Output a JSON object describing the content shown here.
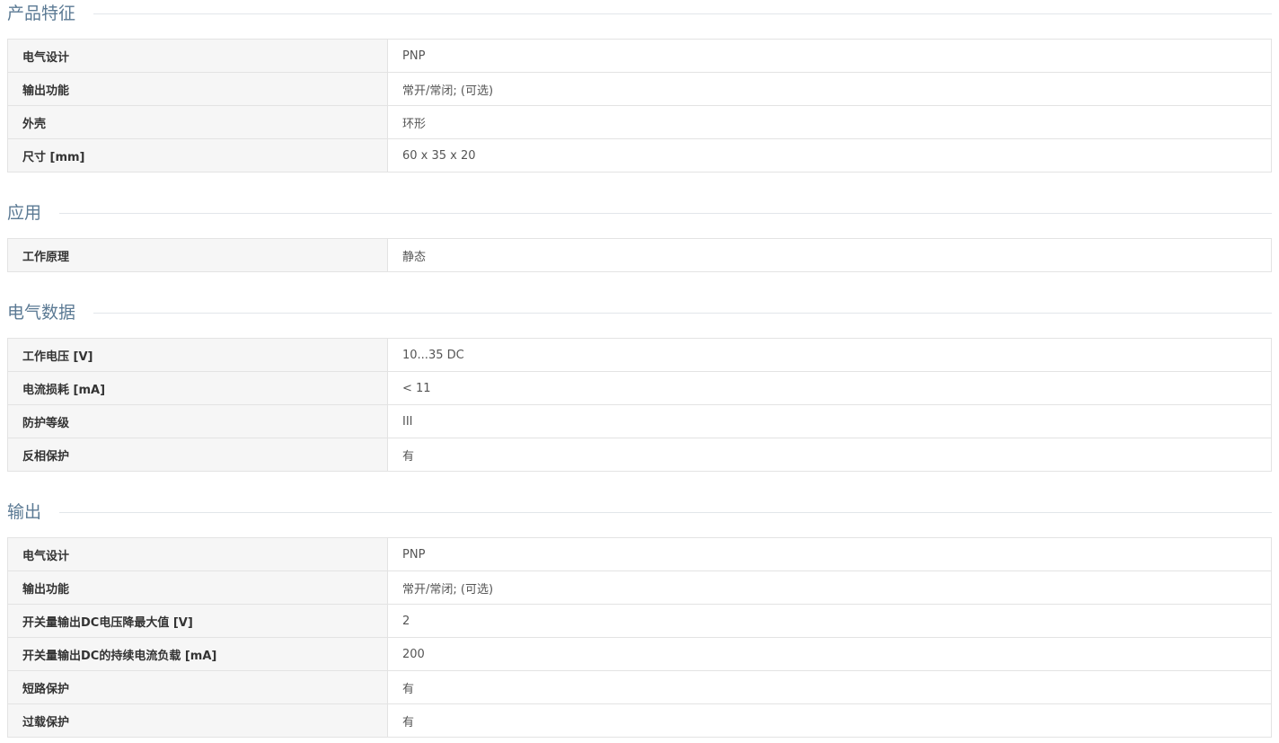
{
  "sections": [
    {
      "title": "产品特征",
      "rows": [
        {
          "label": "电气设计",
          "value": "PNP"
        },
        {
          "label": "输出功能",
          "value": "常开/常闭; (可选)"
        },
        {
          "label": "外壳",
          "value": "环形"
        },
        {
          "label": "尺寸 [mm]",
          "value": "60 x 35 x 20"
        }
      ]
    },
    {
      "title": "应用",
      "rows": [
        {
          "label": "工作原理",
          "value": "静态"
        }
      ]
    },
    {
      "title": "电气数据",
      "rows": [
        {
          "label": "工作电压 [V]",
          "value": "10...35 DC"
        },
        {
          "label": "电流损耗 [mA]",
          "value": "< 11"
        },
        {
          "label": "防护等级",
          "value": "III"
        },
        {
          "label": "反相保护",
          "value": "有"
        }
      ]
    },
    {
      "title": "输出",
      "rows": [
        {
          "label": "电气设计",
          "value": "PNP"
        },
        {
          "label": "输出功能",
          "value": "常开/常闭; (可选)"
        },
        {
          "label": "开关量输出DC电压降最大值 [V]",
          "value": "2"
        },
        {
          "label": "开关量输出DC的持续电流负载 [mA]",
          "value": "200"
        },
        {
          "label": "短路保护",
          "value": "有"
        },
        {
          "label": "过载保护",
          "value": "有"
        }
      ]
    }
  ]
}
